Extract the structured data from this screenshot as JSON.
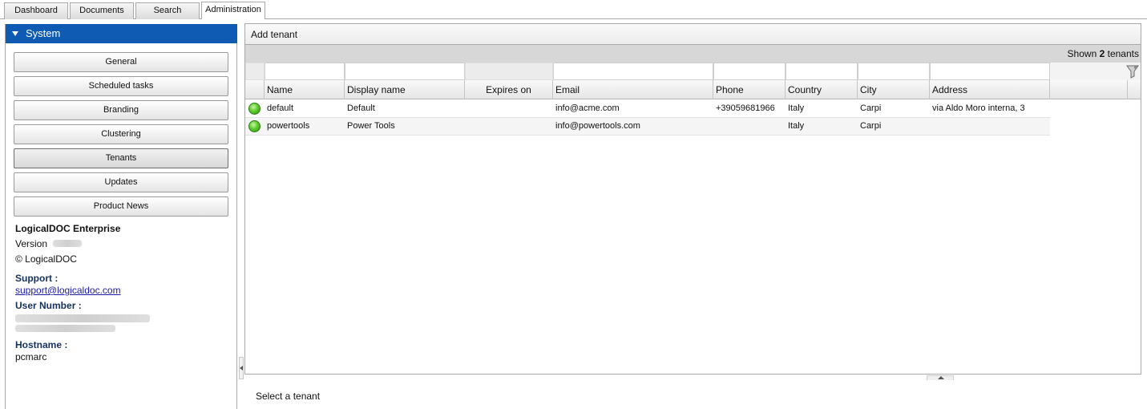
{
  "tabs": [
    {
      "label": "Dashboard",
      "active": false
    },
    {
      "label": "Documents",
      "active": false
    },
    {
      "label": "Search",
      "active": false
    },
    {
      "label": "Administration",
      "active": true
    }
  ],
  "sidebar": {
    "section_title": "System",
    "items": [
      {
        "label": "General"
      },
      {
        "label": "Scheduled tasks"
      },
      {
        "label": "Branding"
      },
      {
        "label": "Clustering"
      },
      {
        "label": "Tenants",
        "selected": true
      },
      {
        "label": "Updates"
      },
      {
        "label": "Product News"
      }
    ],
    "product_name": "LogicalDOC Enterprise",
    "version_label": "Version",
    "copyright": "© LogicalDOC",
    "support_label": "Support :",
    "support_email": "support@logicaldoc.com",
    "user_number_label": "User Number :",
    "hostname_label": "Hostname :",
    "hostname": "pcmarc"
  },
  "toolbar": {
    "add_tenant_label": "Add tenant"
  },
  "grid": {
    "shown_prefix": "Shown",
    "shown_count": "2",
    "shown_suffix": "tenants",
    "columns": [
      "Name",
      "Display name",
      "Expires on",
      "Email",
      "Phone",
      "Country",
      "City",
      "Address"
    ],
    "rows": [
      {
        "status": "enabled",
        "name": "default",
        "display_name": "Default",
        "expires_on": "",
        "email": "info@acme.com",
        "phone": "+39059681966",
        "country": "Italy",
        "city": "Carpi",
        "address": "via Aldo Moro interna, 3"
      },
      {
        "status": "enabled",
        "name": "powertools",
        "display_name": "Power Tools",
        "expires_on": "",
        "email": "info@powertools.com",
        "phone": "",
        "country": "Italy",
        "city": "Carpi",
        "address": ""
      }
    ]
  },
  "details": {
    "empty_message": "Select a tenant"
  },
  "colors": {
    "section_header_bg": "#0f5bb3",
    "status_enabled": "#5fcd2f",
    "label_blue": "#15315f",
    "link": "#1a1aa6"
  }
}
